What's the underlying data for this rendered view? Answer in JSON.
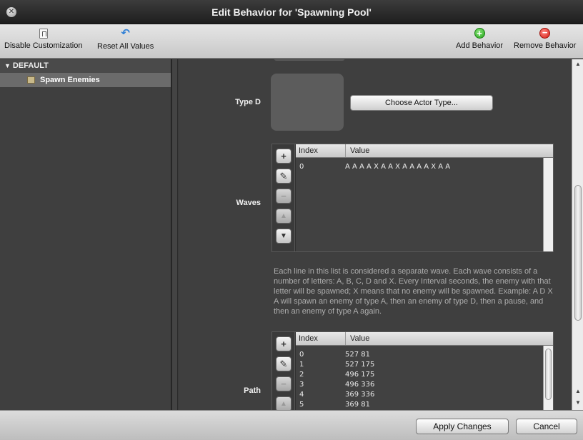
{
  "window": {
    "title": "Edit Behavior for 'Spawning Pool'"
  },
  "toolbar": {
    "disable_label": "Disable Customization",
    "reset_label": "Reset All Values",
    "add_label": "Add Behavior",
    "remove_label": "Remove Behavior"
  },
  "sidebar": {
    "section": "DEFAULT",
    "items": [
      {
        "label": "Spawn Enemies"
      }
    ]
  },
  "fields": {
    "type_d": {
      "label": "Type D",
      "button": "Choose Actor Type..."
    },
    "waves": {
      "label": "Waves",
      "columns": [
        "Index",
        "Value"
      ],
      "rows": [
        {
          "index": "0",
          "value": "A A A A X A A X A A A A X A A"
        }
      ],
      "description": "Each line in this list is considered a separate wave. Each wave consists of a number of letters: A, B, C, D and X. Every Interval seconds, the enemy with that letter will be spawned; X means that no enemy will be spawned. Example: A D X A will spawn an enemy of type A, then an enemy of type D, then a pause, and then an enemy of type A again."
    },
    "path": {
      "label": "Path",
      "columns": [
        "Index",
        "Value"
      ],
      "rows": [
        {
          "index": "0",
          "value": "527 81"
        },
        {
          "index": "1",
          "value": "527 175"
        },
        {
          "index": "2",
          "value": "496 175"
        },
        {
          "index": "3",
          "value": "496 336"
        },
        {
          "index": "4",
          "value": "369 336"
        },
        {
          "index": "5",
          "value": "369 81"
        }
      ]
    }
  },
  "list_buttons": {
    "add": "+",
    "edit": "✎",
    "remove": "−",
    "up": "▲",
    "down": "▼"
  },
  "footer": {
    "apply_label": "Apply Changes",
    "cancel_label": "Cancel"
  }
}
